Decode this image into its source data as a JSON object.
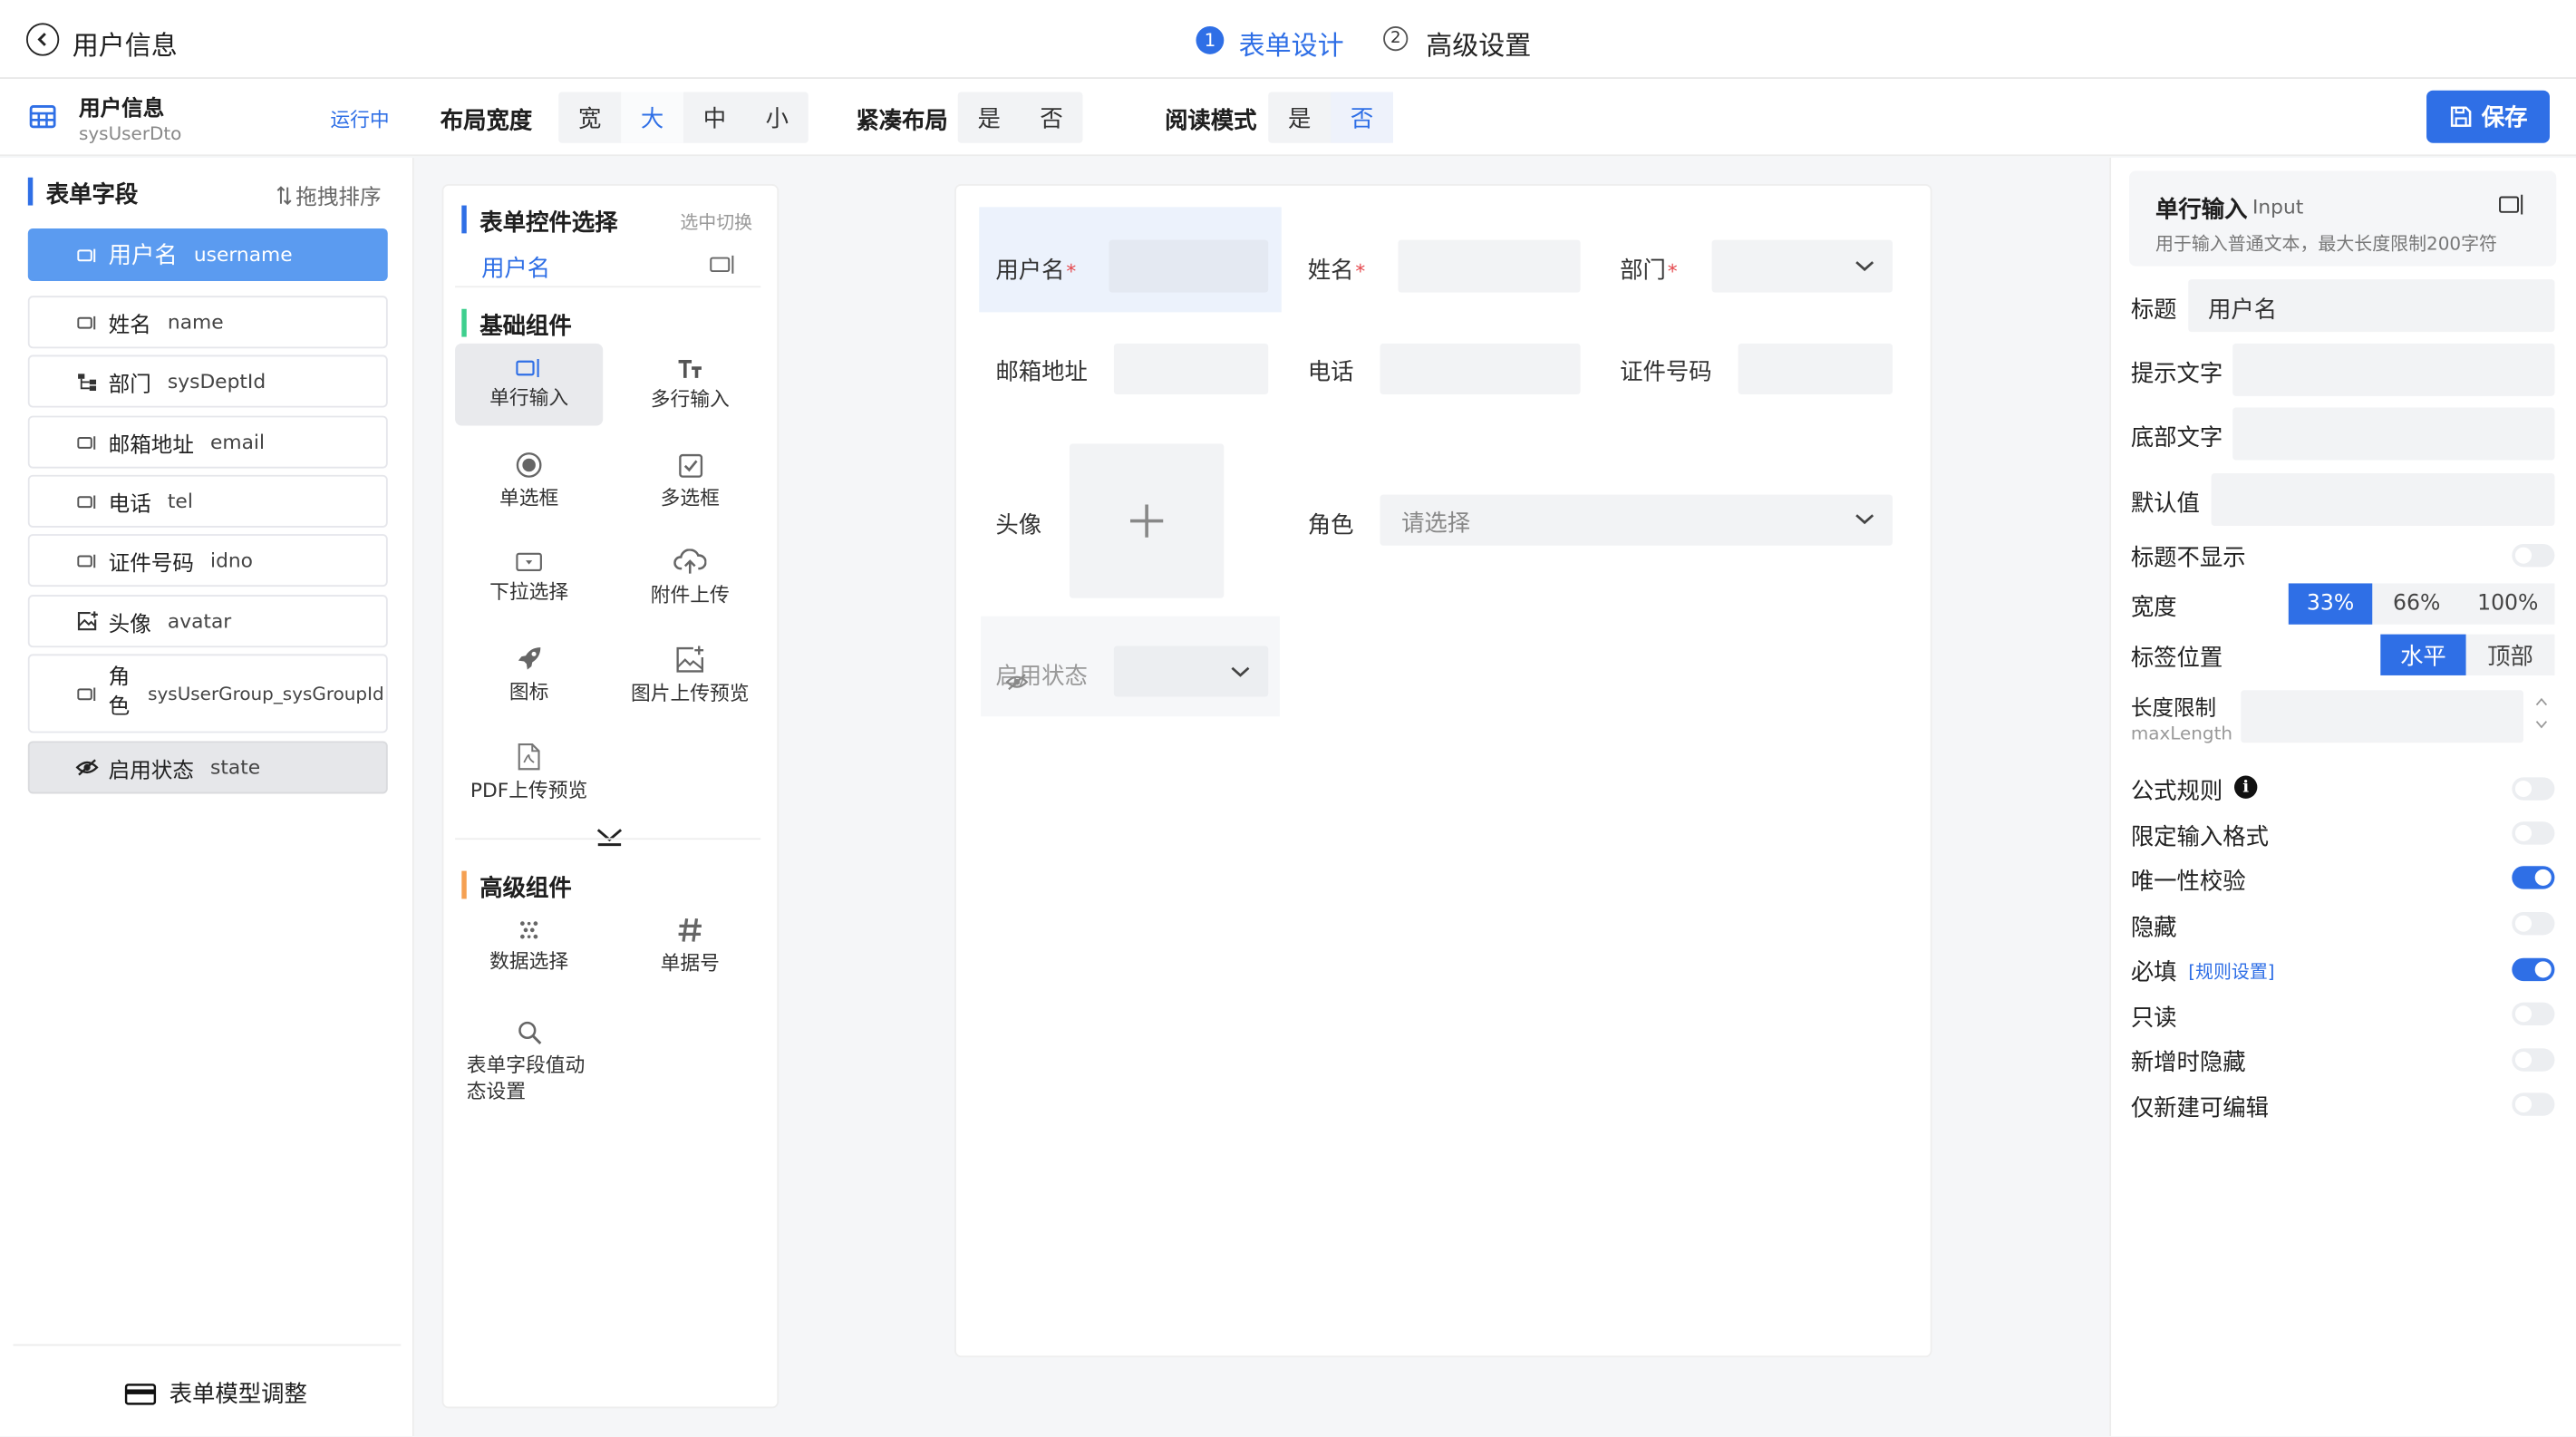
{
  "header": {
    "title": "用户信息",
    "steps": [
      {
        "num": "1",
        "label": "表单设计"
      },
      {
        "num": "2",
        "label": "高级设置"
      }
    ]
  },
  "toolbar": {
    "form_name": "用户信息",
    "form_code": "sysUserDto",
    "status": "运行中",
    "layout_width_label": "布局宽度",
    "layout_width_options": [
      "宽",
      "大",
      "中",
      "小"
    ],
    "layout_width_selected": "大",
    "compact_label": "紧凑布局",
    "compact_options": [
      "是",
      "否"
    ],
    "read_mode_label": "阅读模式",
    "read_mode_options": [
      "是",
      "否"
    ],
    "read_mode_selected": "否",
    "save_label": "保存",
    "accent": "#2f6fe6"
  },
  "fields_panel": {
    "title": "表单字段",
    "sort_label": "拖拽排序",
    "items": [
      {
        "label": "用户名",
        "code": "username",
        "icon": "input-icon"
      },
      {
        "label": "姓名",
        "code": "name",
        "icon": "input-icon"
      },
      {
        "label": "部门",
        "code": "sysDeptId",
        "icon": "tree-icon"
      },
      {
        "label": "邮箱地址",
        "code": "email",
        "icon": "input-icon"
      },
      {
        "label": "电话",
        "code": "tel",
        "icon": "input-icon"
      },
      {
        "label": "证件号码",
        "code": "idno",
        "icon": "input-icon"
      },
      {
        "label": "头像",
        "code": "avatar",
        "icon": "image-upload-icon"
      },
      {
        "label": "角色",
        "code": "sysUserGroup_sysGroupId",
        "icon": "input-icon"
      },
      {
        "label": "启用状态",
        "code": "state",
        "icon": "eye-off-icon"
      }
    ],
    "model_adjust": "表单模型调整"
  },
  "components_panel": {
    "title": "表单控件选择",
    "switch_label": "选中切换",
    "current": "用户名",
    "basic_title": "基础组件",
    "basic": [
      {
        "label": "单行输入",
        "icon": "single-input-icon"
      },
      {
        "label": "多行输入",
        "icon": "multi-input-icon"
      },
      {
        "label": "单选框",
        "icon": "radio-icon"
      },
      {
        "label": "多选框",
        "icon": "checkbox-icon"
      },
      {
        "label": "下拉选择",
        "icon": "select-icon"
      },
      {
        "label": "附件上传",
        "icon": "upload-icon"
      },
      {
        "label": "图标",
        "icon": "rocket-icon"
      },
      {
        "label": "图片上传预览",
        "icon": "image-preview-icon"
      },
      {
        "label": "PDF上传预览",
        "icon": "pdf-icon"
      }
    ],
    "advanced_title": "高级组件",
    "advanced": [
      {
        "label": "数据选择",
        "icon": "data-select-icon"
      },
      {
        "label": "单据号",
        "icon": "hash-icon"
      },
      {
        "label": "表单字段值动态设置",
        "icon": "search-icon"
      }
    ]
  },
  "canvas": {
    "username_label": "用户名",
    "name_label": "姓名",
    "dept_label": "部门",
    "email_label": "邮箱地址",
    "tel_label": "电话",
    "idno_label": "证件号码",
    "avatar_label": "头像",
    "role_label": "角色",
    "role_placeholder": "请选择",
    "state_label": "启用状态"
  },
  "props": {
    "type_name": "单行输入",
    "type_code": "Input",
    "type_desc": "用于输入普通文本，最大长度限制200字符",
    "title_label": "标题",
    "title_value": "用户名",
    "hint_label": "提示文字",
    "footer_label": "底部文字",
    "default_label": "默认值",
    "hide_title_label": "标题不显示",
    "width_label": "宽度",
    "width_options": [
      "33%",
      "66%",
      "100%"
    ],
    "width_selected": "33%",
    "label_pos_label": "标签位置",
    "label_pos_options": [
      "水平",
      "顶部"
    ],
    "label_pos_selected": "水平",
    "length_label": "长度限制",
    "length_sub": "maxLength",
    "formula_label": "公式规则",
    "limit_format_label": "限定输入格式",
    "unique_label": "唯一性校验",
    "unique_on": true,
    "hidden_label": "隐藏",
    "required_label": "必填",
    "required_rule_link": "[规则设置]",
    "required_on": true,
    "readonly_label": "只读",
    "hide_on_add_label": "新增时隐藏",
    "edit_on_create_label": "仅新建可编辑"
  }
}
